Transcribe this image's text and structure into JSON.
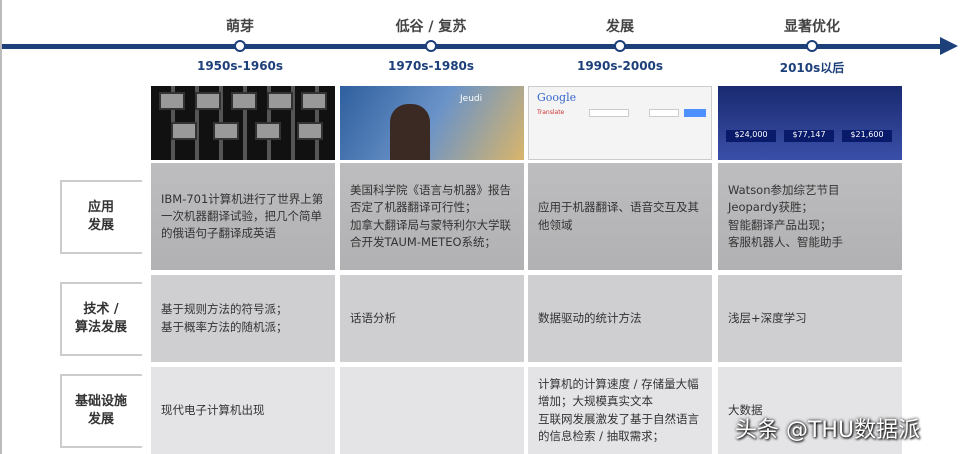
{
  "timeline": [
    {
      "phase": "萌芽",
      "date": "1950s-1960s"
    },
    {
      "phase": "低谷 / 复苏",
      "date": "1970s-1980s"
    },
    {
      "phase": "发展",
      "date": "1990s-2000s"
    },
    {
      "phase": "显著优化",
      "date": "2010s以后"
    }
  ],
  "images": {
    "google_logo": "Google",
    "translate": "Translate",
    "jeopardy_scores": [
      "$24,000",
      "$77,147",
      "$21,600"
    ],
    "weather_map": "Jeudi"
  },
  "rows": [
    {
      "label": "应用\n发展",
      "cells": [
        "IBM-701计算机进行了世界上第一次机器翻译试验，把几个简单的俄语句子翻译成英语",
        "美国科学院《语言与机器》报告否定了机器翻译可行性；\n加拿大翻译局与蒙特利尔大学联合开发TAUM-METEO系统；",
        "应用于机器翻译、语音交互及其他领域",
        "Watson参加综艺节目\nJeopardy获胜；\n智能翻译产品出现；\n客服机器人、智能助手"
      ]
    },
    {
      "label": "技术 /\n算法发展",
      "cells": [
        "基于规则方法的符号派；\n基于概率方法的随机派；",
        "话语分析",
        "数据驱动的统计方法",
        "浅层+深度学习"
      ]
    },
    {
      "label": "基础设施\n发展",
      "cells": [
        "现代电子计算机出现",
        "",
        "计算机的计算速度 / 存储量大幅增加；大规模真实文本\n互联网发展激发了基于自然语言的信息检索 / 抽取需求；",
        "大数据"
      ]
    }
  ],
  "watermark": "头条 @THU数据派",
  "colors": {
    "timeline": "#1d3f7a"
  }
}
